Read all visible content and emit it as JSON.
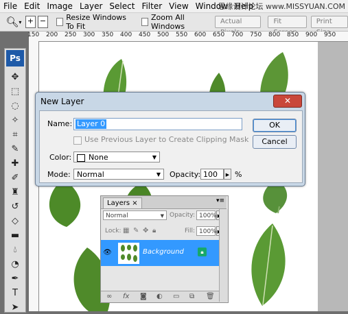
{
  "menu": [
    "File",
    "Edit",
    "Image",
    "Layer",
    "Select",
    "Filter",
    "View",
    "Window",
    "Help"
  ],
  "watermark": "思缘设计论坛  www.MISSYUAN.COM",
  "options": {
    "resize_label": "Resize Windows To Fit",
    "zoom_all_label": "Zoom All Windows",
    "actual_pixels": "Actual Pixels",
    "fit_screen": "Fit Screen",
    "print_size": "Print Size"
  },
  "ruler": [
    "150",
    "200",
    "250",
    "300",
    "350",
    "400",
    "450",
    "500",
    "550",
    "600",
    "650",
    "700",
    "750",
    "800",
    "850",
    "900",
    "950"
  ],
  "toolbox": {
    "logo": "Ps"
  },
  "dialog": {
    "title": "New Layer",
    "close": "✕",
    "name_label": "Name:",
    "name_value": "Layer 0",
    "clip_label": "Use Previous Layer to Create Clipping Mask",
    "color_label": "Color:",
    "color_value": "None",
    "mode_label": "Mode:",
    "mode_value": "Normal",
    "opacity_label": "Opacity:",
    "opacity_value": "100",
    "opacity_unit": "%",
    "ok": "OK",
    "cancel": "Cancel"
  },
  "layers": {
    "tab": "Layers",
    "tab_close": "×",
    "blend": "Normal",
    "opacity_label": "Opacity:",
    "opacity_value": "100%",
    "lock_label": "Lock:",
    "fill_label": "Fill:",
    "fill_value": "100%",
    "layer_name": "Background"
  },
  "colors": {
    "selection": "#3399ff",
    "leaf": "#4f8a2a",
    "dialog_frame": "#c8d7e6",
    "close": "#c9473a"
  }
}
